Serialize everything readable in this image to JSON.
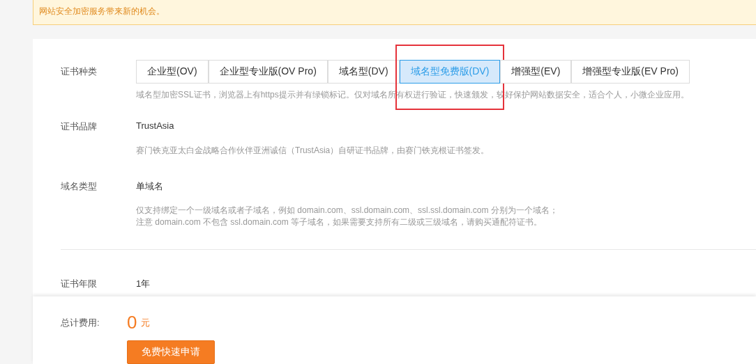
{
  "notice": {
    "text": "网站安全加密服务带来新的机会。"
  },
  "form": {
    "type_label": "证书种类",
    "tabs": [
      {
        "label": "企业型(OV)",
        "selected": false,
        "highlighted": false
      },
      {
        "label": "企业型专业版(OV Pro)",
        "selected": false,
        "highlighted": false
      },
      {
        "label": "域名型(DV)",
        "selected": false,
        "highlighted": false
      },
      {
        "label": "域名型免费版(DV)",
        "selected": true,
        "highlighted": true
      },
      {
        "label": "增强型(EV)",
        "selected": false,
        "highlighted": false
      },
      {
        "label": "增强型专业版(EV Pro)",
        "selected": false,
        "highlighted": false
      }
    ],
    "type_hint": "域名型加密SSL证书，浏览器上有https提示并有绿锁标记。仅对域名所有权进行验证，快速颁发，较好保护网站数据安全，适合个人，小微企业应用。",
    "rows": [
      {
        "label": "证书品牌",
        "value": "TrustAsia",
        "hints": [
          "赛门铁克亚太白金战略合作伙伴亚洲诚信（TrustAsia）自研证书品牌，由赛门铁克根证书签发。"
        ]
      },
      {
        "label": "域名类型",
        "value": "单域名",
        "hints": [
          "仅支持绑定一个一级域名或者子域名，例如 domain.com、ssl.domain.com、ssl.ssl.domain.com 分别为一个域名；",
          "注意 domain.com 不包含 ssl.domain.com 等子域名，如果需要支持所有二级或三级域名，请购买通配符证书。"
        ]
      }
    ],
    "term": {
      "label": "证书年限",
      "value": "1年"
    }
  },
  "footer": {
    "total_label": "总计费用:",
    "amount": "0",
    "unit": "元",
    "button": "免费快速申请"
  }
}
